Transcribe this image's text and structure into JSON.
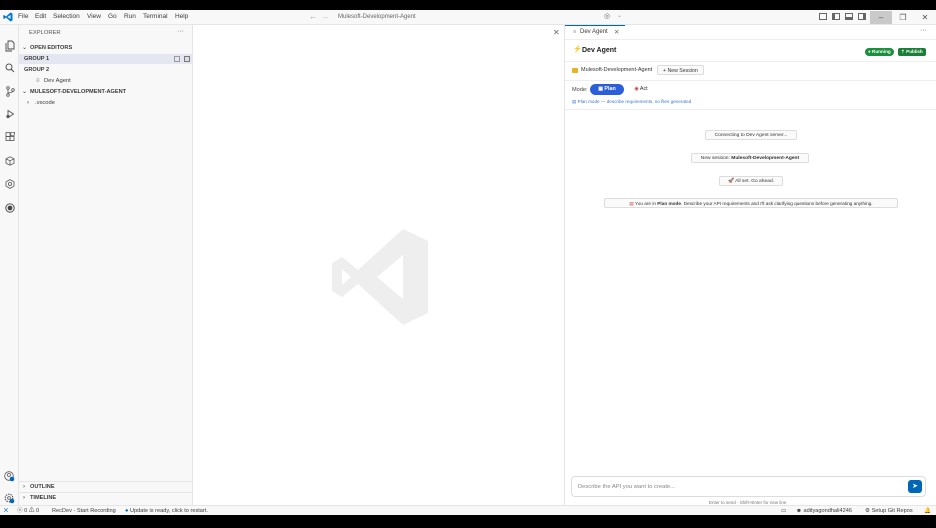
{
  "menu": [
    "File",
    "Edit",
    "Selection",
    "View",
    "Go",
    "Run",
    "Terminal",
    "Help"
  ],
  "command_center": "Mulesoft-Development-Agent",
  "sidebar": {
    "title": "EXPLORER",
    "open_editors": "OPEN EDITORS",
    "group1": "GROUP 1",
    "group2": "GROUP 2",
    "dev_agent_item": "Dev Agent",
    "project": "MULESOFT-DEVELOPMENT-AGENT",
    "vscode_folder": ".vscode",
    "outline": "OUTLINE",
    "timeline": "TIMELINE"
  },
  "panel": {
    "tab_label": "Dev Agent",
    "title": "Dev Agent",
    "running": "● Running",
    "publish": "⇡ Publish",
    "project_name": "Mulesoft-Development-Agent",
    "new_session": "+ New Session",
    "mode_label": "Mode:",
    "plan": "Plan",
    "act": "Act",
    "mode_hint": "Plan mode — describe requirements, no files generated",
    "msg_connecting": "Connecting to Dev Agent server...",
    "msg_new_session_prefix": "New session: ",
    "msg_new_session_name": "Mulesoft-Development-Agent",
    "msg_all_set": "All set. Go ahead.",
    "msg_plan_prefix": "You are in ",
    "msg_plan_bold": "Plan mode",
    "msg_plan_rest": ". Describe your API requirements and I'll ask clarifying questions before generating anything.",
    "input_placeholder": "Describe the API you want to create...",
    "input_hint": "Enter to send · Shift+Enter for new line"
  },
  "status": {
    "errors": "0",
    "warnings": "0",
    "recdev": "RecDev - Start Recording",
    "update": "Update is ready, click to restart.",
    "user": "adityagondhali4246",
    "git": "Setup Git Repos"
  },
  "colors": {
    "accent": "#0066b8",
    "running": "#1a8f3c",
    "publish": "#1a7f37",
    "plan_button": "#2b5fd9"
  }
}
